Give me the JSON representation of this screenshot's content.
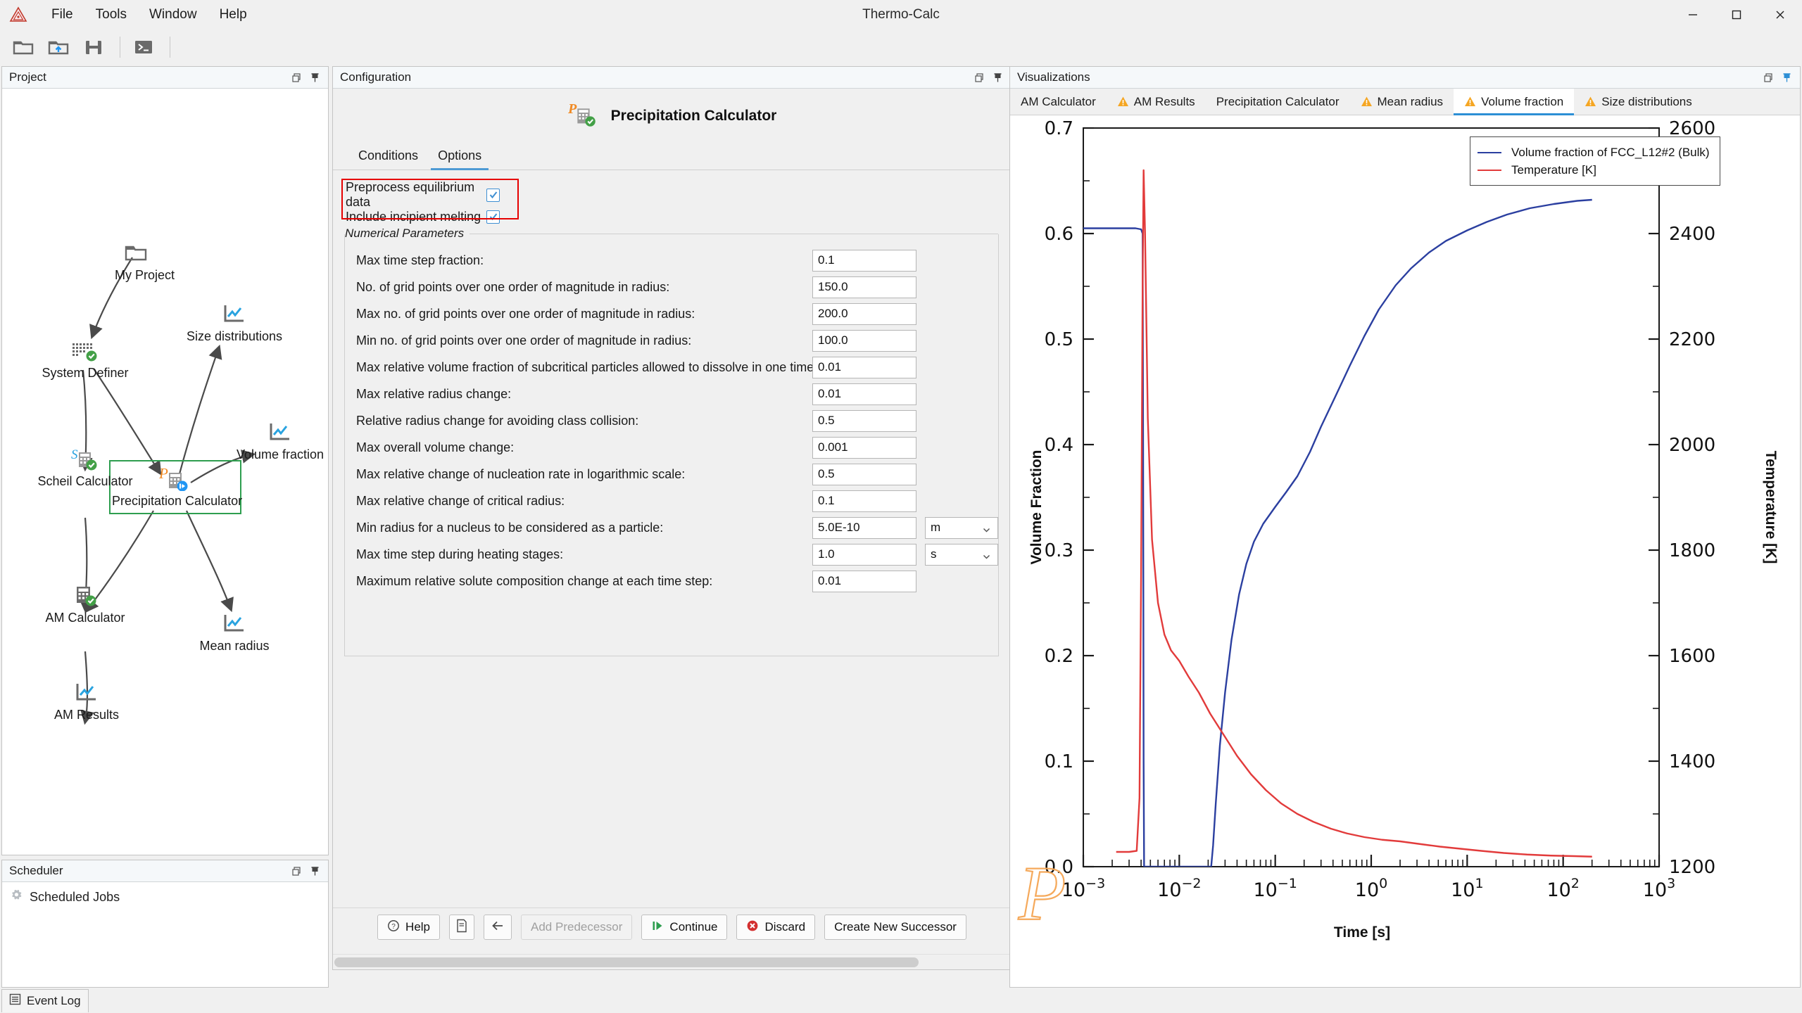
{
  "window": {
    "title": "Thermo-Calc",
    "logo_icon": "thermocalc-triangle-logo",
    "minimize_icon": "minimize-icon",
    "maximize_icon": "maximize-icon",
    "close_icon": "close-icon"
  },
  "menu": {
    "items": [
      {
        "label": "File"
      },
      {
        "label": "Tools"
      },
      {
        "label": "Window"
      },
      {
        "label": "Help"
      }
    ]
  },
  "toolbar": {
    "buttons": [
      {
        "name": "open-project",
        "icon": "folder-icon"
      },
      {
        "name": "open-recent-project",
        "icon": "folder-upload-icon"
      },
      {
        "name": "save-project",
        "icon": "save-floppy-icon"
      },
      {
        "name": "console-mode",
        "icon": "console-terminal-icon"
      }
    ]
  },
  "project": {
    "title": "Project",
    "restore_icon": "restore-window-icon",
    "pin_icon": "pin-icon",
    "nodes": [
      {
        "id": "my-project",
        "label": "My Project",
        "icon": "folder-icon",
        "status": "none"
      },
      {
        "id": "system-definer",
        "label": "System Definer",
        "icon": "system-definer-icon",
        "status": "success"
      },
      {
        "id": "size-distributions",
        "label": "Size distributions",
        "icon": "plot-icon",
        "status": "none"
      },
      {
        "id": "scheil-calculator",
        "label": "Scheil Calculator",
        "icon": "scheil-calculator-icon",
        "status": "success"
      },
      {
        "id": "precipitation-calculator",
        "label": "Precipitation Calculator",
        "icon": "precipitation-calculator-icon",
        "status": "running"
      },
      {
        "id": "volume-fraction",
        "label": "Volume fraction",
        "icon": "plot-icon",
        "status": "none"
      },
      {
        "id": "am-calculator",
        "label": "AM Calculator",
        "icon": "am-calculator-icon",
        "status": "success"
      },
      {
        "id": "mean-radius",
        "label": "Mean radius",
        "icon": "plot-icon",
        "status": "none"
      },
      {
        "id": "am-results",
        "label": "AM Results",
        "icon": "plot-icon",
        "status": "none"
      }
    ],
    "selection_color": "#2e9e4f"
  },
  "scheduler": {
    "title": "Scheduler",
    "restore_icon": "restore-window-icon",
    "pin_icon": "pin-icon",
    "root_item": "Scheduled Jobs",
    "root_icon": "gear-icon"
  },
  "event_log": {
    "label": "Event Log",
    "icon": "log-list-icon"
  },
  "configuration": {
    "title": "Configuration",
    "restore_icon": "restore-window-icon",
    "pin_icon": "pin-icon",
    "calculator_title": "Precipitation Calculator",
    "calculator_icon": "precipitation-calculator-icon",
    "tabs": [
      {
        "label": "Conditions",
        "active": false
      },
      {
        "label": "Options",
        "active": true
      }
    ],
    "highlight_color": "#e60000",
    "options": [
      {
        "label": "Preprocess equilibrium data",
        "checked": true
      },
      {
        "label": "Include incipient melting",
        "checked": true
      }
    ],
    "numerical_parameters": {
      "group_title": "Numerical Parameters",
      "rows": [
        {
          "label": "Max time step fraction:",
          "value": "0.1",
          "unit": null
        },
        {
          "label": "No. of grid points over one order of magnitude in radius:",
          "value": "150.0",
          "unit": null
        },
        {
          "label": "Max no. of grid points over one order of magnitude in radius:",
          "value": "200.0",
          "unit": null
        },
        {
          "label": "Min no. of grid points over one order of magnitude in radius:",
          "value": "100.0",
          "unit": null
        },
        {
          "label": "Max relative volume fraction of subcritical particles allowed to dissolve in one time step:",
          "value": "0.01",
          "unit": null
        },
        {
          "label": "Max relative radius change:",
          "value": "0.01",
          "unit": null
        },
        {
          "label": "Relative radius change for avoiding class collision:",
          "value": "0.5",
          "unit": null
        },
        {
          "label": "Max overall volume change:",
          "value": "0.001",
          "unit": null
        },
        {
          "label": "Max relative change of nucleation rate in logarithmic scale:",
          "value": "0.5",
          "unit": null
        },
        {
          "label": "Max relative change of critical radius:",
          "value": "0.1",
          "unit": null
        },
        {
          "label": "Min radius for a nucleus to be considered as a particle:",
          "value": "5.0E-10",
          "unit": "m"
        },
        {
          "label": "Max time step during heating stages:",
          "value": "1.0",
          "unit": "s"
        },
        {
          "label": "Maximum relative solute composition change at each time step:",
          "value": "0.01",
          "unit": null
        }
      ]
    },
    "footer_buttons": [
      {
        "label": "Help",
        "icon": "help-question-icon",
        "disabled": false
      },
      {
        "label": "",
        "icon": "document-icon",
        "disabled": false
      },
      {
        "label": "",
        "icon": "arrow-left-icon",
        "disabled": false
      },
      {
        "label": "Add Predecessor",
        "icon": null,
        "disabled": true
      },
      {
        "label": "Continue",
        "icon": "play-continue-icon",
        "disabled": false
      },
      {
        "label": "Discard",
        "icon": "discard-x-icon",
        "disabled": false
      },
      {
        "label": "Create New Successor",
        "icon": null,
        "disabled": false
      }
    ]
  },
  "visualizations": {
    "title": "Visualizations",
    "restore_icon": "restore-window-icon",
    "pin_icon": "pin-icon",
    "tabs": [
      {
        "label": "AM Calculator",
        "warning": false,
        "active": false
      },
      {
        "label": "AM Results",
        "warning": true,
        "active": false
      },
      {
        "label": "Precipitation Calculator",
        "warning": false,
        "active": false
      },
      {
        "label": "Mean radius",
        "warning": true,
        "active": false
      },
      {
        "label": "Volume fraction",
        "warning": true,
        "active": true
      },
      {
        "label": "Size distributions",
        "warning": true,
        "active": false
      }
    ],
    "watermark_icon": "thermocalc-p-watermark"
  },
  "chart_data": {
    "type": "line",
    "title": "",
    "xlabel": "Time [s]",
    "ylabel": "Volume Fraction",
    "y2label": "Temperature [K]",
    "xscale": "log",
    "xlim": [
      0.001,
      1000
    ],
    "xticks": [
      0.001,
      0.01,
      0.1,
      1,
      10,
      100,
      1000
    ],
    "xticklabels": [
      "10⁻³",
      "10⁻²",
      "10⁻¹",
      "10⁰",
      "10¹",
      "10²",
      "10³"
    ],
    "ylim": [
      0.0,
      0.7
    ],
    "yticks": [
      0.0,
      0.1,
      0.2,
      0.3,
      0.4,
      0.5,
      0.6,
      0.7
    ],
    "yticklabels": [
      "0.0",
      "0.1",
      "0.2",
      "0.3",
      "0.4",
      "0.5",
      "0.6",
      "0.7"
    ],
    "y2lim": [
      1200,
      2600
    ],
    "y2ticks": [
      1200,
      1400,
      1600,
      1800,
      2000,
      2200,
      2400,
      2600
    ],
    "y2ticklabels": [
      "1200",
      "1400",
      "1600",
      "1800",
      "2000",
      "2200",
      "2400",
      "2600"
    ],
    "grid": false,
    "legend_position": "top-right",
    "series": [
      {
        "name": "Volume fraction of FCC_L12#2 (Bulk)",
        "color": "#2b3fa0",
        "axis": "left",
        "points": [
          [
            0.001,
            0.605
          ],
          [
            0.0025,
            0.605
          ],
          [
            0.0035,
            0.605
          ],
          [
            0.004,
            0.604
          ],
          [
            0.00415,
            0.6
          ],
          [
            0.0042,
            0.4
          ],
          [
            0.00425,
            0.1
          ],
          [
            0.0043,
            0.0
          ],
          [
            0.006,
            0.0
          ],
          [
            0.012,
            0.0
          ],
          [
            0.02,
            0.0
          ],
          [
            0.0215,
            0.0
          ],
          [
            0.0225,
            0.02
          ],
          [
            0.024,
            0.06
          ],
          [
            0.0265,
            0.115
          ],
          [
            0.03,
            0.165
          ],
          [
            0.035,
            0.215
          ],
          [
            0.042,
            0.258
          ],
          [
            0.05,
            0.287
          ],
          [
            0.06,
            0.308
          ],
          [
            0.075,
            0.325
          ],
          [
            0.1,
            0.341
          ],
          [
            0.13,
            0.355
          ],
          [
            0.17,
            0.37
          ],
          [
            0.23,
            0.393
          ],
          [
            0.3,
            0.417
          ],
          [
            0.42,
            0.445
          ],
          [
            0.6,
            0.475
          ],
          [
            0.85,
            0.503
          ],
          [
            1.2,
            0.528
          ],
          [
            1.8,
            0.551
          ],
          [
            2.6,
            0.567
          ],
          [
            4.0,
            0.582
          ],
          [
            6.0,
            0.593
          ],
          [
            10.0,
            0.603
          ],
          [
            16.0,
            0.611
          ],
          [
            26.0,
            0.618
          ],
          [
            45.0,
            0.624
          ],
          [
            80.0,
            0.628
          ],
          [
            140.0,
            0.631
          ],
          [
            200.0,
            0.632
          ]
        ]
      },
      {
        "name": "Temperature [K]",
        "color": "#e23b3b",
        "axis": "right",
        "points": [
          [
            0.0022,
            1228
          ],
          [
            0.003,
            1228
          ],
          [
            0.0036,
            1230
          ],
          [
            0.00385,
            1330
          ],
          [
            0.004,
            1750
          ],
          [
            0.00415,
            2300
          ],
          [
            0.00425,
            2520
          ],
          [
            0.0044,
            2400
          ],
          [
            0.0047,
            2050
          ],
          [
            0.0052,
            1820
          ],
          [
            0.006,
            1700
          ],
          [
            0.007,
            1640
          ],
          [
            0.0082,
            1610
          ],
          [
            0.01,
            1590
          ],
          [
            0.0125,
            1560
          ],
          [
            0.016,
            1530
          ],
          [
            0.021,
            1490
          ],
          [
            0.029,
            1450
          ],
          [
            0.04,
            1410
          ],
          [
            0.056,
            1375
          ],
          [
            0.08,
            1345
          ],
          [
            0.115,
            1320
          ],
          [
            0.17,
            1300
          ],
          [
            0.25,
            1285
          ],
          [
            0.38,
            1272
          ],
          [
            0.56,
            1263
          ],
          [
            0.85,
            1256
          ],
          [
            1.3,
            1251
          ],
          [
            2.0,
            1248
          ],
          [
            3.2,
            1243
          ],
          [
            5.2,
            1238
          ],
          [
            8.5,
            1234
          ],
          [
            14.0,
            1230
          ],
          [
            24.0,
            1226
          ],
          [
            42.0,
            1223
          ],
          [
            75.0,
            1221
          ],
          [
            130.0,
            1220
          ],
          [
            200.0,
            1219
          ]
        ]
      }
    ]
  }
}
